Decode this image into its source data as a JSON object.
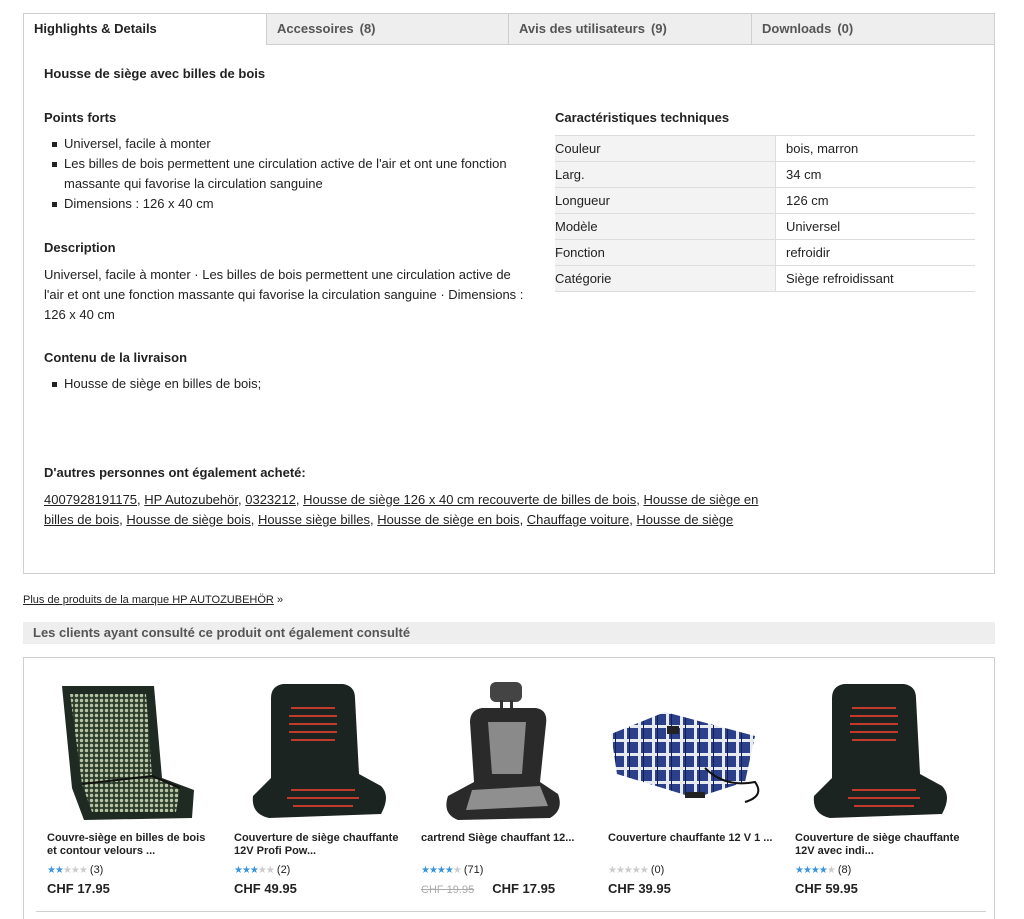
{
  "tabs": [
    {
      "label": "Highlights & Details",
      "count": ""
    },
    {
      "label": "Accessoires",
      "count": "(8)"
    },
    {
      "label": "Avis des utilisateurs",
      "count": "(9)"
    },
    {
      "label": "Downloads",
      "count": "(0)"
    }
  ],
  "product_title": "Housse de siège avec billes de bois",
  "highlights": {
    "heading": "Points forts",
    "items": [
      "Universel, facile à monter",
      "Les billes de bois permettent une circulation active de l'air et ont une fonction massante qui favorise la circulation sanguine",
      "Dimensions : 126 x 40 cm"
    ]
  },
  "description": {
    "heading": "Description",
    "text": "Universel, facile à monter · Les billes de bois permettent une circulation active de l'air et ont une fonction massante qui favorise la circulation sanguine · Dimensions : 126 x 40 cm"
  },
  "delivery": {
    "heading": "Contenu de la livraison",
    "items": [
      "Housse de siège en billes de bois;"
    ]
  },
  "specs": {
    "heading": "Caractéristiques techniques",
    "rows": [
      {
        "key": "Couleur",
        "value": "bois, marron"
      },
      {
        "key": "Larg.",
        "value": "34 cm"
      },
      {
        "key": "Longueur",
        "value": "126 cm"
      },
      {
        "key": "Modèle",
        "value": "Universel"
      },
      {
        "key": "Fonction",
        "value": "refroidir"
      },
      {
        "key": "Catégorie",
        "value": "Siège refroidissant"
      }
    ]
  },
  "also_bought": {
    "heading": "D'autres personnes ont également acheté:",
    "tags": [
      "4007928191175",
      "HP Autozubehör",
      "0323212",
      "Housse de siège 126 x 40 cm recouverte de billes de bois",
      "Housse de siège en billes de bois",
      "Housse de siège bois",
      "Housse siège billes",
      "Housse de siège en bois",
      "Chauffage voiture",
      "Housse de siège"
    ]
  },
  "brand_link": {
    "text": "Plus de produits de la marque HP AUTOZUBEHÖR",
    "arrow": "»"
  },
  "viewed": {
    "heading": "Les clients ayant consulté ce produit ont également consulté",
    "products": [
      {
        "name": "Couvre-siège en billes de bois et contour velours ...",
        "stars": 2,
        "reviews": "(3)",
        "old_price": "",
        "price": "CHF 17.95",
        "image": "beaded-seat-cover"
      },
      {
        "name": "Couverture de siège chauffante 12V Profi Pow...",
        "stars": 3,
        "reviews": "(2)",
        "old_price": "",
        "price": "CHF 49.95",
        "image": "heated-seat-cover"
      },
      {
        "name": "cartrend Siège chauffant 12...",
        "stars": 4,
        "reviews": "(71)",
        "old_price": "CHF 19.95",
        "price": "CHF 17.95",
        "image": "grey-seat-cushion"
      },
      {
        "name": "Couverture chauffante 12 V 1 ...",
        "stars": 0,
        "reviews": "(0)",
        "old_price": "",
        "price": "CHF 39.95",
        "image": "plaid-blanket"
      },
      {
        "name": "Couverture de siège chauffante 12V avec indi...",
        "stars": 4,
        "reviews": "(8)",
        "old_price": "",
        "price": "CHF 59.95",
        "image": "heated-seat-cover"
      }
    ]
  }
}
